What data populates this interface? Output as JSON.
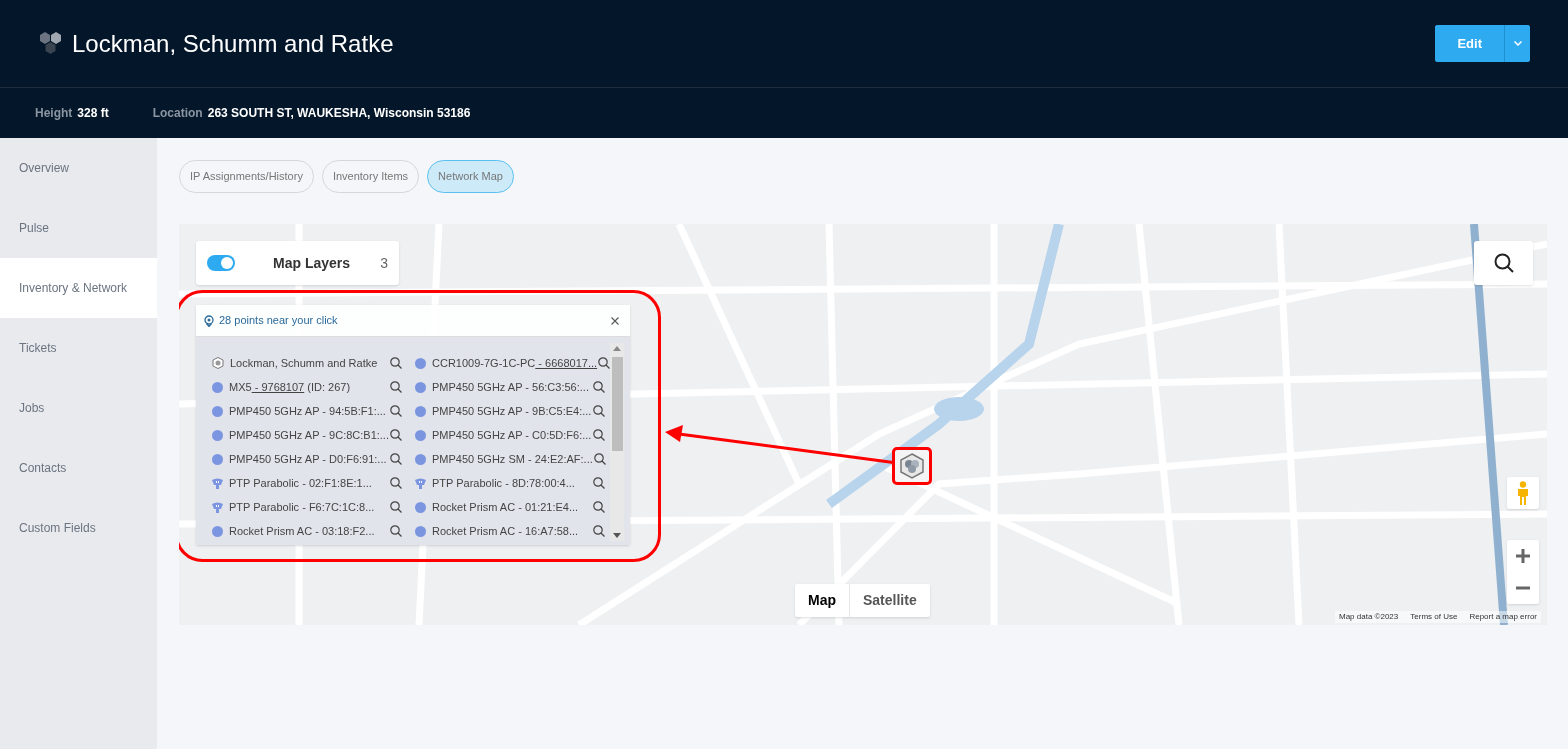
{
  "header": {
    "title": "Lockman, Schumm and Ratke",
    "edit_button": "Edit"
  },
  "info": [
    {
      "label": "Height",
      "value": "328 ft"
    },
    {
      "label": "Location",
      "value": "263 SOUTH ST, WAUKESHA, Wisconsin 53186"
    }
  ],
  "sidebar": {
    "items": [
      {
        "label": "Overview",
        "selected": false
      },
      {
        "label": "Pulse",
        "selected": false
      },
      {
        "label": "Inventory & Network",
        "selected": true
      },
      {
        "label": "Tickets",
        "selected": false
      },
      {
        "label": "Jobs",
        "selected": false
      },
      {
        "label": "Contacts",
        "selected": false
      },
      {
        "label": "Custom Fields",
        "selected": false
      }
    ]
  },
  "tabs": [
    {
      "label": "IP Assignments/History",
      "selected": false
    },
    {
      "label": "Inventory Items",
      "selected": false
    },
    {
      "label": "Network Map",
      "selected": true
    }
  ],
  "map": {
    "layers_panel": {
      "title": "Map Layers",
      "count": "3",
      "on": true
    },
    "popup": {
      "title": "28 points near your click",
      "items": [
        {
          "kind": "site",
          "name": "Lockman, Schumm and Ratke"
        },
        {
          "kind": "device",
          "name": "CCR1009-7G-1C-PC",
          "link": " - 6668017..."
        },
        {
          "kind": "device",
          "name": "MX5",
          "link": " - 9768107",
          "suffix": " (ID: 267)"
        },
        {
          "kind": "device",
          "name": "PMP450 5GHz AP - 56:C3:56:..."
        },
        {
          "kind": "device",
          "name": "PMP450 5GHz AP - 94:5B:F1:..."
        },
        {
          "kind": "device",
          "name": "PMP450 5GHz AP - 9B:C5:E4:..."
        },
        {
          "kind": "device",
          "name": "PMP450 5GHz AP - 9C:8C:B1:..."
        },
        {
          "kind": "device",
          "name": "PMP450 5GHz AP - C0:5D:F6:..."
        },
        {
          "kind": "device",
          "name": "PMP450 5GHz AP - D0:F6:91:..."
        },
        {
          "kind": "device",
          "name": "PMP450 5GHz SM - 24:E2:AF:..."
        },
        {
          "kind": "ptp",
          "name": "PTP Parabolic - 02:F1:8E:1..."
        },
        {
          "kind": "ptp",
          "name": "PTP Parabolic - 8D:78:00:4..."
        },
        {
          "kind": "ptp",
          "name": "PTP Parabolic - F6:7C:1C:8..."
        },
        {
          "kind": "device",
          "name": "Rocket Prism AC - 01:21:E4..."
        },
        {
          "kind": "device",
          "name": "Rocket Prism AC - 03:18:F2..."
        },
        {
          "kind": "device",
          "name": "Rocket Prism AC - 16:A7:58..."
        }
      ]
    },
    "type_buttons": [
      {
        "label": "Map",
        "selected": true
      },
      {
        "label": "Satellite",
        "selected": false
      }
    ],
    "footer": [
      "Map data ©2023",
      "Terms of Use",
      "Report a map error"
    ]
  }
}
